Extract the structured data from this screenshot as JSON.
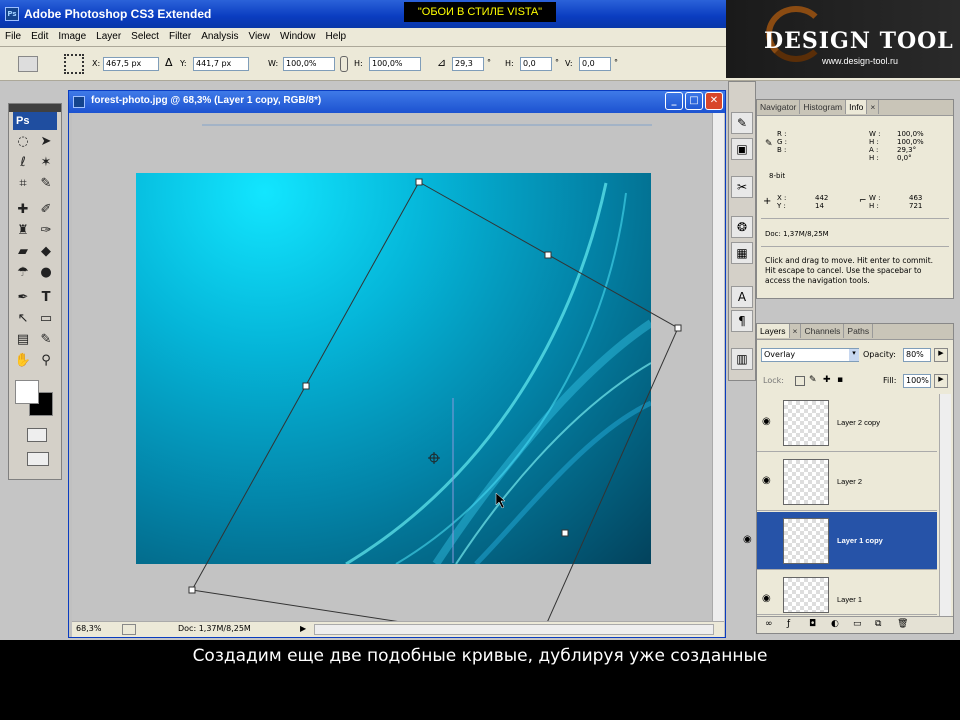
{
  "app": {
    "title": "Adobe Photoshop CS3 Extended",
    "ps_icon": "Ps",
    "banner": "\"ОБОИ В СТИЛЕ VISTA\""
  },
  "window_controls": {
    "minimize": "_",
    "maximize": "□",
    "close": "✕"
  },
  "logo": {
    "brand": "DESIGN TOOL",
    "url": "www.design-tool.ru"
  },
  "menu": [
    "File",
    "Edit",
    "Image",
    "Layer",
    "Select",
    "Filter",
    "Analysis",
    "View",
    "Window",
    "Help"
  ],
  "options_bar": {
    "x_label": "X:",
    "x_value": "467,5 px",
    "y_label": "Y:",
    "y_value": "441,7 px",
    "w_label": "W:",
    "w_value": "100,0%",
    "h_label": "H:",
    "h_value": "100,0%",
    "angle_value": "29,3",
    "angle_unit": "°",
    "hskew_label": "H:",
    "hskew_value": "0,0",
    "hskew_unit": "°",
    "vskew_label": "V:",
    "vskew_value": "0,0",
    "vskew_unit": "°"
  },
  "toolbox": {
    "logo": "Ps"
  },
  "document": {
    "title": "forest-photo.jpg @ 68,3% (Layer 1 copy, RGB/8*)",
    "zoom": "68,3%",
    "doc_size": "Doc: 1,37M/8,25M"
  },
  "navigator_panel": {
    "tabs": [
      "Navigator",
      "Histogram",
      "Info"
    ],
    "close": "×",
    "info": {
      "r_label": "R :",
      "g_label": "G :",
      "b_label": "B :",
      "w_label": "W :",
      "w_value": "100,0%",
      "h_label": "H :",
      "h_value": "100,0%",
      "a_label": "A :",
      "a_value": "29,3°",
      "hs_label": "H :",
      "hs_value": "0,0°",
      "bit": "8-bit",
      "x_label": "X :",
      "x_value": "442",
      "y_label": "Y :",
      "y_value": "14",
      "w2_label": "W :",
      "w2_value": "463",
      "h2_label": "H :",
      "h2_value": "721",
      "doc": "Doc: 1,37M/8,25M",
      "hint": "Click and drag to move. Hit enter to commit. Hit escape to cancel. Use the spacebar to access the navigation tools."
    }
  },
  "layers_panel": {
    "tabs": [
      "Layers",
      "Channels",
      "Paths"
    ],
    "close": "×",
    "blend_mode": "Overlay",
    "opacity_label": "Opacity:",
    "opacity_value": "80%",
    "lock_label": "Lock:",
    "fill_label": "Fill:",
    "fill_value": "100%",
    "layers": [
      {
        "name": "Layer 2 copy"
      },
      {
        "name": "Layer 2"
      },
      {
        "name": "Layer 1 copy"
      },
      {
        "name": "Layer 1"
      }
    ],
    "selected_index": 2
  },
  "caption": "Создадим еще две подобные кривые, дублируя уже созданные",
  "colors": {
    "titlebar": "#0a3cc0",
    "selection": "#2653a8",
    "panel_bg": "#ece9d8"
  }
}
